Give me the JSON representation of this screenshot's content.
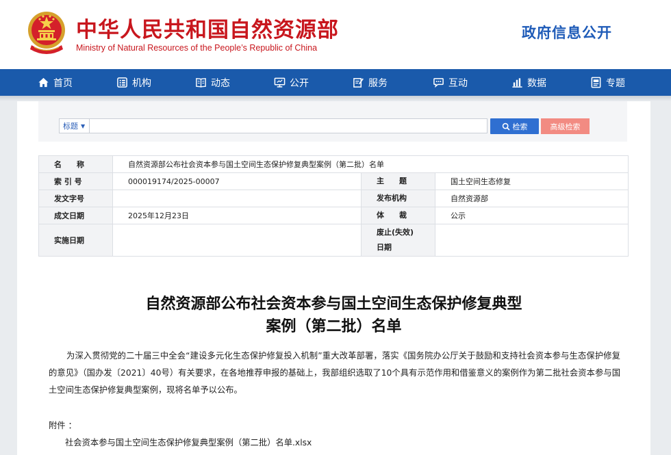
{
  "header": {
    "title_cn": "中华人民共和国自然资源部",
    "title_en": "Ministry of Natural Resources of the People’s Republic of China",
    "right_title": "政府信息公开"
  },
  "nav": {
    "items": [
      {
        "label": "首页",
        "icon": "home-icon"
      },
      {
        "label": "机构",
        "icon": "org-icon"
      },
      {
        "label": "动态",
        "icon": "book-icon"
      },
      {
        "label": "公开",
        "icon": "monitor-icon"
      },
      {
        "label": "服务",
        "icon": "edit-icon"
      },
      {
        "label": "互动",
        "icon": "chat-icon"
      },
      {
        "label": "数据",
        "icon": "bar-chart-icon"
      },
      {
        "label": "专题",
        "icon": "topic-icon"
      }
    ]
  },
  "search": {
    "scope": "标题",
    "value": "",
    "search_label": "检索",
    "advanced_label": "高级检索"
  },
  "meta": {
    "name_label": "名　　称",
    "name_value": "自然资源部公布社会资本参与国土空间生态保护修复典型案例（第二批）名单",
    "index_label": "索 引 号",
    "index_value": "000019174/2025-00007",
    "subject_label": "主　　题",
    "subject_value": "国土空间生态修复",
    "docno_label": "发文字号",
    "docno_value": "",
    "issuer_label": "发布机构",
    "issuer_value": "自然资源部",
    "date_label": "成文日期",
    "date_value": "2025年12月23日",
    "genre_label": "体　　裁",
    "genre_value": "公示",
    "impl_label": "实施日期",
    "impl_value": "",
    "expire_label_1": "废止(失效)",
    "expire_label_2": "日期",
    "expire_value": ""
  },
  "article": {
    "title_line1": "自然资源部公布社会资本参与国土空间生态保护修复典型",
    "title_line2": "案例（第二批）名单",
    "body": "为深入贯彻党的二十届三中全会“建设多元化生态保护修复投入机制”重大改革部署，落实《国务院办公厅关于鼓励和支持社会资本参与生态保护修复的意见》（国办发〔2021〕40号）有关要求，在各地推荐申报的基础上，我部组织选取了10个具有示范作用和借鉴意义的案例作为第二批社会资本参与国土空间生态保护修复典型案例，现将名单予以公布。",
    "attachment_label": "附件 ：",
    "attachment_file": "社会资本参与国土空间生态保护修复典型案例（第二批）名单.xlsx"
  },
  "colors": {
    "brand_red": "#c8161d",
    "nav_blue": "#1a5aab",
    "search_blue": "#2f6fd1",
    "advanced_pink": "#f28b82"
  }
}
